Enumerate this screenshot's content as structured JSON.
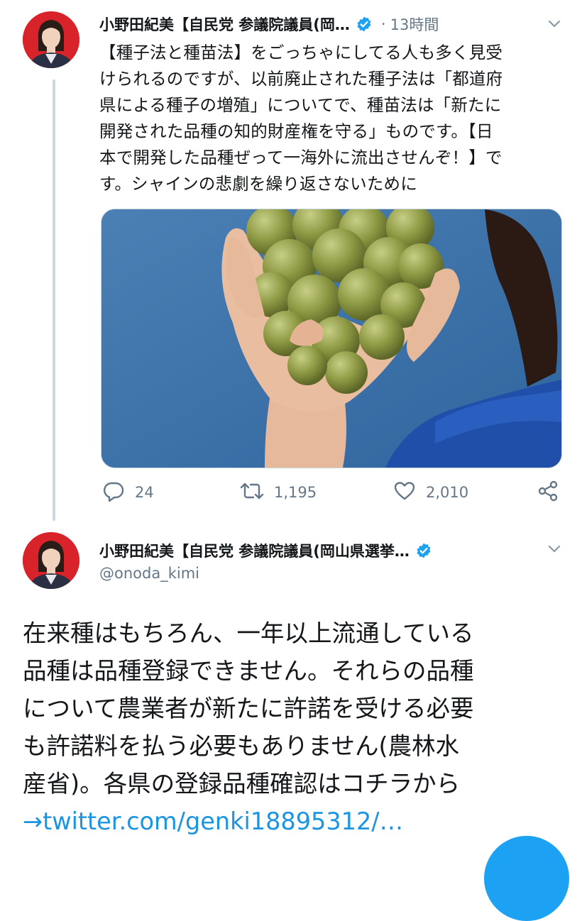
{
  "tweet1": {
    "author_name": "小野田紀美【自民党 参議院議員(岡…",
    "verified_icon": "verified-badge-icon",
    "separator": "·",
    "time": "13時間",
    "text": "【種子法と種苗法】をごっちゃにしてる人も多く見受\nけられるのですが、以前廃止された種子法は「都道府\n県による種子の増殖」についてで、種苗法は「新たに\n開発された品種の知的財産権を守る」ものです。【日\n本で開発した品種ぜって一海外に流出させんぞ！】で\nす。シャインの悲劇を繰り返さないために",
    "media_icon": "photo-hand-holding-grapes",
    "actions": {
      "reply_count": "24",
      "retweet_count": "1,195",
      "like_count": "2,010"
    }
  },
  "tweet2": {
    "author_name": "小野田紀美【自民党 参議院議員(岡山県選挙…",
    "handle": "@onoda_kimi",
    "text": "在来種はもちろん、一年以上流通している\n品種は品種登録できません。それらの品種\nについて農業者が新たに許諾を受ける必要\nも許諾料を払う必要もありません(農林水\n産省)。各県の登録品種確認はコチラから\n",
    "link": "→twitter.com/genki18895312/…"
  },
  "colors": {
    "accent": "#1da1f2",
    "link": "#1b95e0",
    "muted": "#657786",
    "avatar_bg": "#d9232a"
  }
}
